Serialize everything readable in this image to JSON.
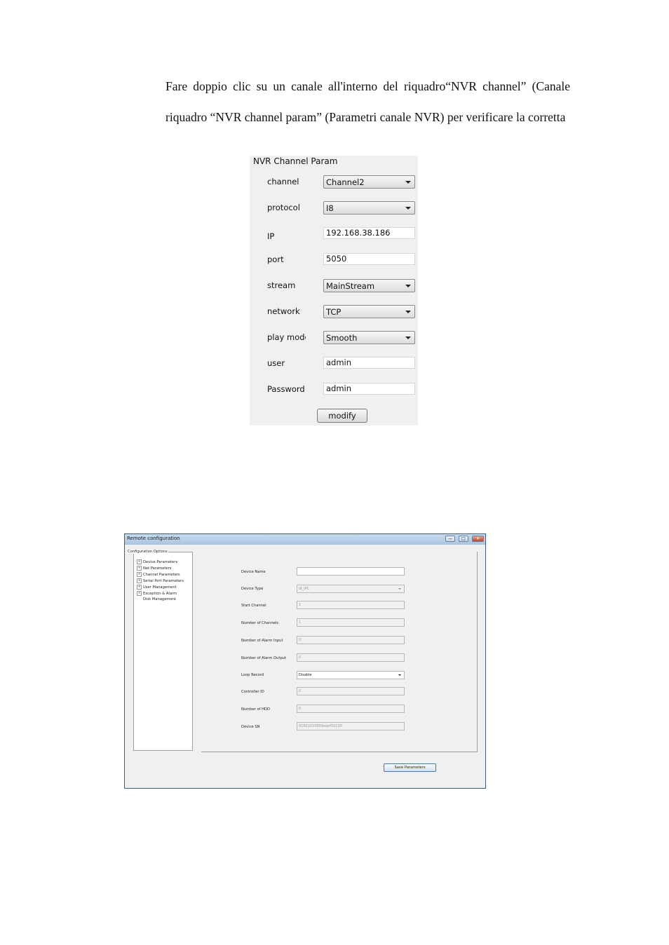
{
  "document": {
    "paragraph_line1": "Fare doppio clic su un canale all'interno del riquadro“NVR channel” (Canale",
    "paragraph_line2": "riquadro “NVR channel param” (Parametri canale NVR) per verificare la corretta"
  },
  "nvr_panel": {
    "title": "NVR Channel Param",
    "rows": [
      {
        "label": "channel",
        "value": "Channel2",
        "kind": "select"
      },
      {
        "label": "protocol",
        "value": "I8",
        "kind": "select"
      },
      {
        "label": "IP",
        "value": "192.168.38.186",
        "kind": "text"
      },
      {
        "label": "port",
        "value": "5050",
        "kind": "text"
      },
      {
        "label": "stream",
        "value": "MainStream",
        "kind": "select"
      },
      {
        "label": "network",
        "value": "TCP",
        "kind": "select"
      },
      {
        "label": "play mode",
        "value": "Smooth",
        "kind": "select"
      },
      {
        "label": "user",
        "value": "admin",
        "kind": "text"
      },
      {
        "label": "Password",
        "value": "admin",
        "kind": "text"
      }
    ],
    "modify_label": "modify"
  },
  "remote_window": {
    "title": "Remote configuration",
    "buttons": {
      "minimize": "—",
      "maximize": "□",
      "close": "✕"
    },
    "tree_root": "Configuration Options",
    "tree_items": [
      "Device Parameters",
      "Net Parameters",
      "Channel Parameters",
      "Serial Port Parameters",
      "User Management",
      "Exception & Alarm",
      "Disk Management"
    ],
    "params": [
      {
        "label": "Device Name",
        "value": ""
      },
      {
        "label": "Device Type",
        "value": "I8_IPC"
      },
      {
        "label": "Start Channel",
        "value": "1"
      },
      {
        "label": "Number of Channels",
        "value": "1"
      },
      {
        "label": "Number of Alarm Input",
        "value": "0"
      },
      {
        "label": "Number of Alarm Output",
        "value": "0"
      },
      {
        "label": "Loop Record",
        "value": "Disable"
      },
      {
        "label": "Controller ID",
        "value": "0"
      },
      {
        "label": "Number of HDD",
        "value": "0"
      },
      {
        "label": "Device SN",
        "value": "01801010659eaef59130"
      }
    ],
    "save_label": "Save Parameters"
  }
}
